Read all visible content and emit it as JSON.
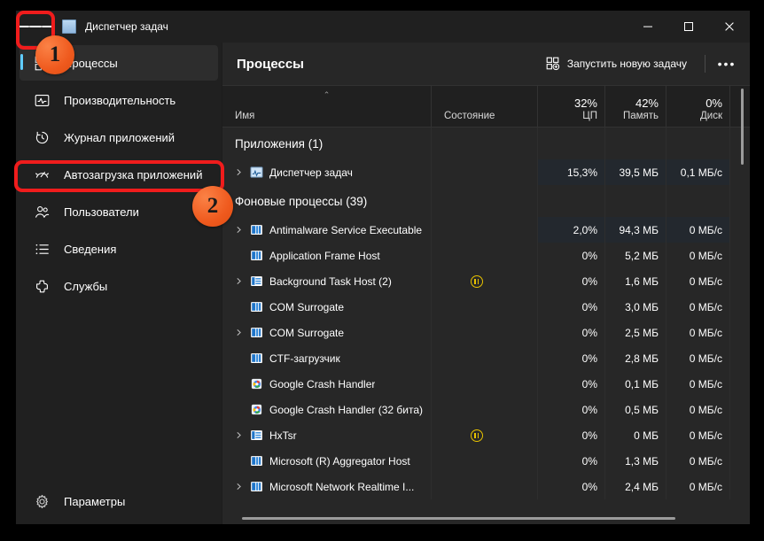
{
  "window": {
    "title": "Диспетчер задач",
    "hamburger_name": "Открыть навигацию",
    "minimize": "—",
    "maximize": "☐",
    "close": "✕"
  },
  "sidebar": {
    "items": [
      {
        "label": "Процессы",
        "icon": "processes-icon",
        "selected": true
      },
      {
        "label": "Производительность",
        "icon": "performance-icon",
        "selected": false
      },
      {
        "label": "Журнал приложений",
        "icon": "app-history-icon",
        "selected": false
      },
      {
        "label": "Автозагрузка приложений",
        "icon": "startup-apps-icon",
        "selected": false
      },
      {
        "label": "Пользователи",
        "icon": "users-icon",
        "selected": false
      },
      {
        "label": "Сведения",
        "icon": "details-icon",
        "selected": false
      },
      {
        "label": "Службы",
        "icon": "services-icon",
        "selected": false
      }
    ],
    "settings": {
      "label": "Параметры",
      "icon": "gear-icon"
    }
  },
  "main": {
    "title": "Процессы",
    "new_task_label": "Запустить новую задачу",
    "more_label": "•••"
  },
  "table": {
    "sort_indicator": "⌃",
    "columns": [
      {
        "key": "name",
        "pct": "",
        "label": "Имя"
      },
      {
        "key": "state",
        "pct": "",
        "label": "Состояние"
      },
      {
        "key": "cpu",
        "pct": "32%",
        "label": "ЦП"
      },
      {
        "key": "mem",
        "pct": "42%",
        "label": "Память"
      },
      {
        "key": "disk",
        "pct": "0%",
        "label": "Диск"
      }
    ],
    "rows": [
      {
        "type": "group",
        "name": "Приложения (1)",
        "state": "",
        "cpu": "",
        "mem": "",
        "disk": "",
        "chevron": false,
        "icon": "",
        "shaded": false
      },
      {
        "type": "proc",
        "name": "Диспетчер задач",
        "state": "",
        "cpu": "15,3%",
        "mem": "39,5 МБ",
        "disk": "0,1 МБ/с",
        "chevron": true,
        "icon": "taskmgr-icon",
        "shaded": true
      },
      {
        "type": "group",
        "name": "Фоновые процессы (39)",
        "state": "",
        "cpu": "",
        "mem": "",
        "disk": "",
        "chevron": false,
        "icon": "",
        "shaded": false
      },
      {
        "type": "proc",
        "name": "Antimalware Service Executable",
        "state": "",
        "cpu": "2,0%",
        "mem": "94,3 МБ",
        "disk": "0 МБ/с",
        "chevron": true,
        "icon": "app-blue-icon",
        "shaded": true
      },
      {
        "type": "proc",
        "name": "Application Frame Host",
        "state": "",
        "cpu": "0%",
        "mem": "5,2 МБ",
        "disk": "0 МБ/с",
        "chevron": false,
        "icon": "app-blue-icon",
        "shaded": false
      },
      {
        "type": "proc",
        "name": "Background Task Host (2)",
        "state": "paused",
        "cpu": "0%",
        "mem": "1,6 МБ",
        "disk": "0 МБ/с",
        "chevron": true,
        "icon": "app-list-icon",
        "shaded": false
      },
      {
        "type": "proc",
        "name": "COM Surrogate",
        "state": "",
        "cpu": "0%",
        "mem": "3,0 МБ",
        "disk": "0 МБ/с",
        "chevron": false,
        "icon": "app-blue-icon",
        "shaded": false
      },
      {
        "type": "proc",
        "name": "COM Surrogate",
        "state": "",
        "cpu": "0%",
        "mem": "2,5 МБ",
        "disk": "0 МБ/с",
        "chevron": true,
        "icon": "app-blue-icon",
        "shaded": false
      },
      {
        "type": "proc",
        "name": "CTF-загрузчик",
        "state": "",
        "cpu": "0%",
        "mem": "2,8 МБ",
        "disk": "0 МБ/с",
        "chevron": false,
        "icon": "app-blue-icon",
        "shaded": false
      },
      {
        "type": "proc",
        "name": "Google Crash Handler",
        "state": "",
        "cpu": "0%",
        "mem": "0,1 МБ",
        "disk": "0 МБ/с",
        "chevron": false,
        "icon": "google-crash-icon",
        "shaded": false
      },
      {
        "type": "proc",
        "name": "Google Crash Handler (32 бита)",
        "state": "",
        "cpu": "0%",
        "mem": "0,5 МБ",
        "disk": "0 МБ/с",
        "chevron": false,
        "icon": "google-crash-icon",
        "shaded": false
      },
      {
        "type": "proc",
        "name": "HxTsr",
        "state": "paused",
        "cpu": "0%",
        "mem": "0 МБ",
        "disk": "0 МБ/с",
        "chevron": true,
        "icon": "app-list-icon",
        "shaded": false
      },
      {
        "type": "proc",
        "name": "Microsoft (R) Aggregator Host",
        "state": "",
        "cpu": "0%",
        "mem": "1,3 МБ",
        "disk": "0 МБ/с",
        "chevron": false,
        "icon": "app-blue-icon",
        "shaded": false
      },
      {
        "type": "proc",
        "name": "Microsoft Network Realtime I...",
        "state": "",
        "cpu": "0%",
        "mem": "2,4 МБ",
        "disk": "0 МБ/с",
        "chevron": true,
        "icon": "app-blue-icon",
        "shaded": false
      }
    ]
  },
  "annotations": {
    "highlight_color": "#f01c1c",
    "badge_color": "#ef5a1e",
    "badges": [
      {
        "label": "1"
      },
      {
        "label": "2"
      }
    ]
  }
}
